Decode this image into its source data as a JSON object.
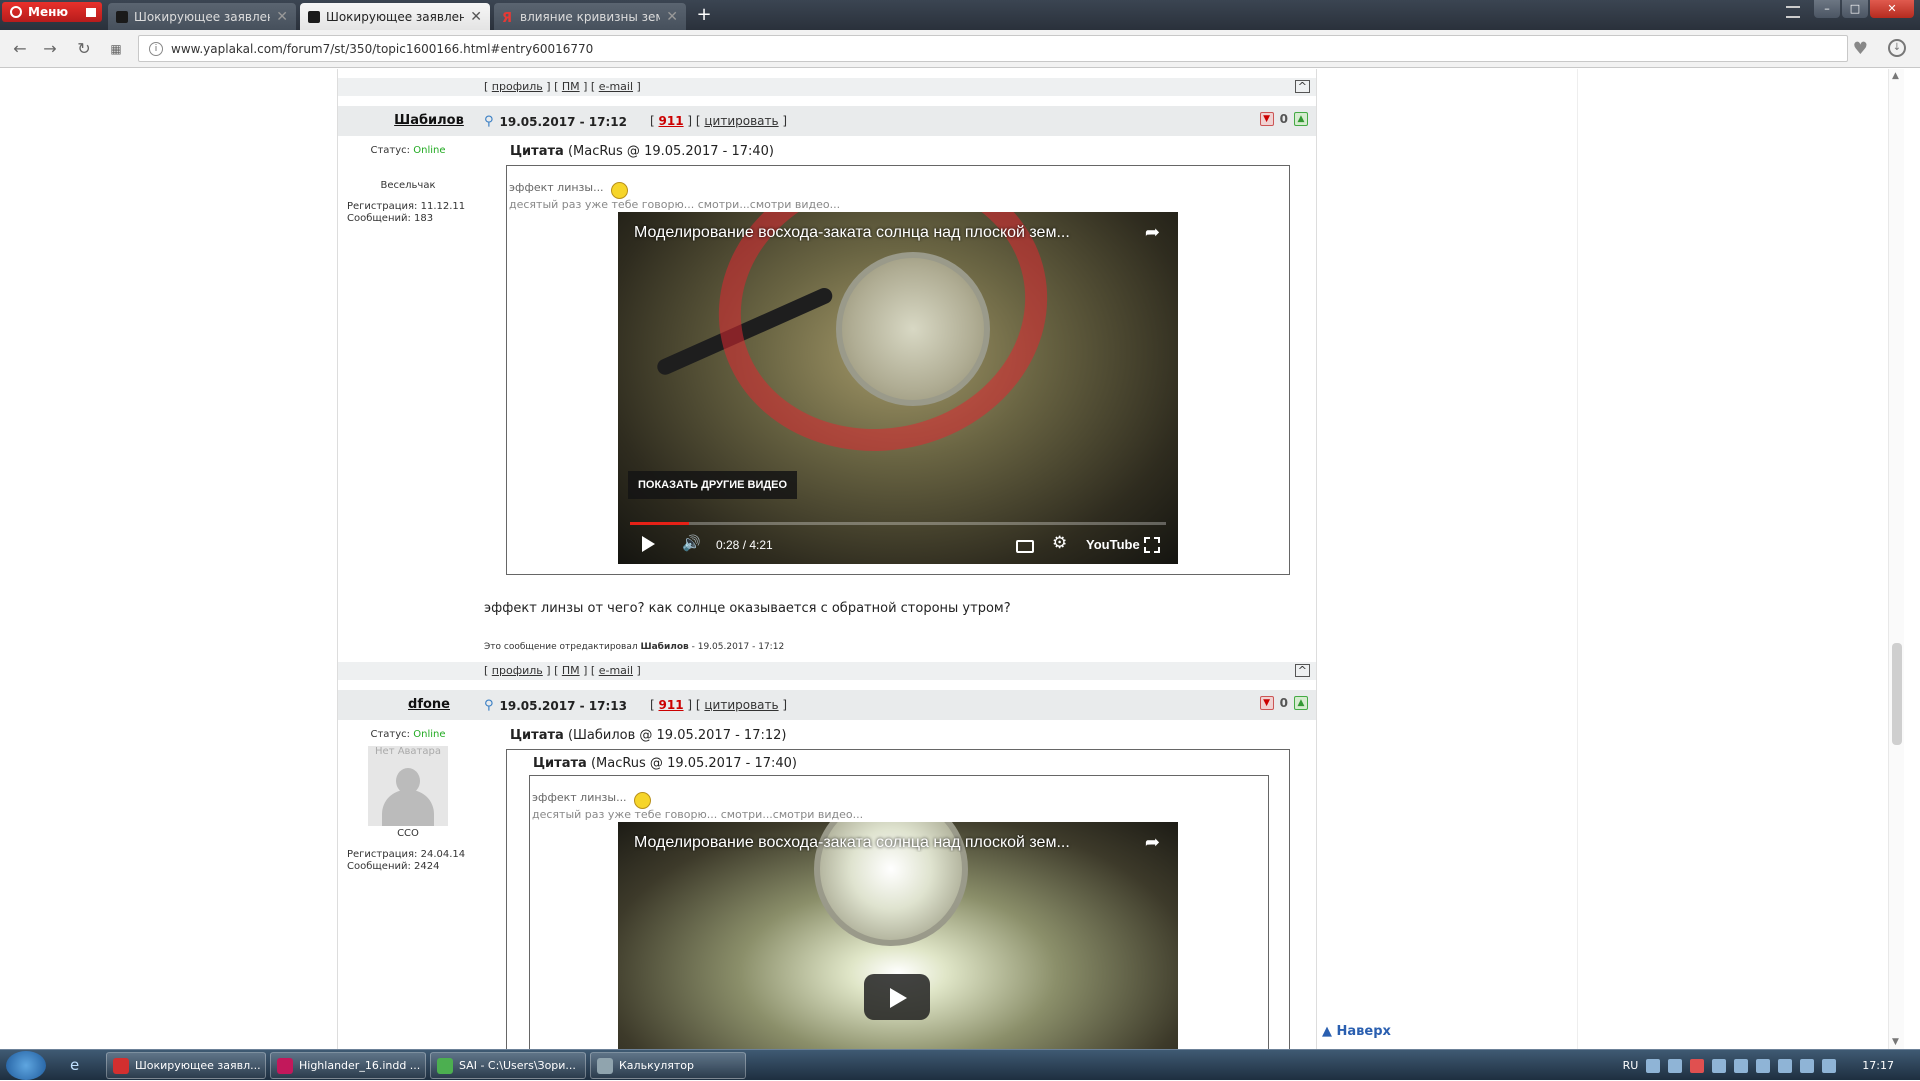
{
  "browser": {
    "menu_label": "Меню",
    "tabs": [
      {
        "title": "Шокирующее заявление",
        "close": "✕"
      },
      {
        "title": "Шокирующее заявление",
        "close": "✕"
      },
      {
        "title": "влияние кривизны земл",
        "close": "✕"
      }
    ],
    "new_tab": "+",
    "url": "www.yaplakal.com/forum7/st/350/topic1600166.html#entry60016770"
  },
  "links_row": {
    "profile": "профиль",
    "pm": "ПМ",
    "email": "e-mail",
    "up": "^"
  },
  "posts": [
    {
      "username": "Шабилов",
      "datetime": "19.05.2017 - 17:12",
      "report": "911",
      "quote_action": "цитировать",
      "rating": "0",
      "status_label": "Статус:",
      "status_value": "Online",
      "rank": "Весельчак",
      "reg": "Регистрация: 11.12.11",
      "msgs": "Сообщений: 183",
      "quote_label": "Цитата",
      "quote_meta": "(MacRus @ 19.05.2017 - 17:40)",
      "q_line1": "эффект линзы...",
      "q_line2": "десятый раз уже тебе говорю... смотри...смотри видео...",
      "video": {
        "title": "Моделирование восхода-заката солнца над плоской зем...",
        "more_videos": "ПОКАЗАТЬ ДРУГИЕ ВИДЕО",
        "time": "0:28 / 4:21",
        "progress": 0.11,
        "logo": "YouTube"
      },
      "text": "эффект линзы от чего? как солнце оказывается с обратной стороны утром?",
      "edited_prefix": "Это сообщение отредактировал",
      "edited_user": "Шабилов",
      "edited_date": "- 19.05.2017 - 17:12"
    },
    {
      "username": "dfone",
      "datetime": "19.05.2017 - 17:13",
      "report": "911",
      "quote_action": "цитировать",
      "rating": "0",
      "status_label": "Статус:",
      "status_value": "Online",
      "avatar_text": "Нет Аватара",
      "rank": "CCO",
      "reg": "Регистрация: 24.04.14",
      "msgs": "Сообщений: 2424",
      "quote_label": "Цитата",
      "quote_meta": "(Шабилов @ 19.05.2017 - 17:12)",
      "inner_quote_label": "Цитата",
      "inner_quote_meta": "(MacRus @ 19.05.2017 - 17:40)",
      "q_line1": "эффект линзы...",
      "q_line2": "десятый раз уже тебе говорю... смотри...смотри видео...",
      "video": {
        "title": "Моделирование восхода-заката солнца над плоской зем..."
      }
    }
  ],
  "naverh": "Наверх",
  "taskbar": {
    "buttons": [
      {
        "label": "Шокирующее заявл...",
        "color": "#d32f2f"
      },
      {
        "label": "Highlander_16.indd ...",
        "color": "#c2185b"
      },
      {
        "label": "SAI - C:\\Users\\Зори...",
        "color": "#4caf50"
      },
      {
        "label": "Калькулятор",
        "color": "#90a4ae"
      }
    ],
    "lang": "RU",
    "time": "17:17"
  }
}
